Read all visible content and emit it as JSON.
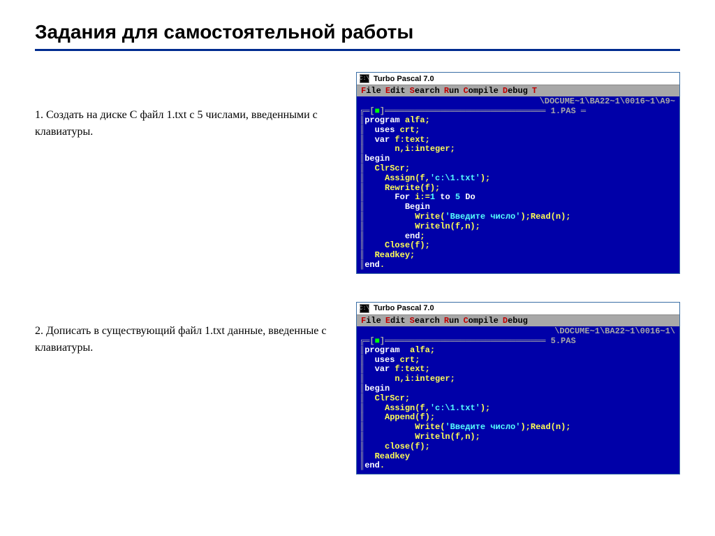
{
  "slide": {
    "title": "Задания для самостоятельной работы"
  },
  "task1": {
    "text": "1. Создать на  диске  C  файл  1.txt  с  5 числами,  введенными с клавиатуры."
  },
  "task2": {
    "text": "2. Дописать  в  существующий  файл  1.txt данные,  введенные с клавиатуры."
  },
  "tp": {
    "app_title": "Turbo Pascal 7.0",
    "cmd_glyph": "C:\\",
    "menu": {
      "file": "File",
      "edit": "Edit",
      "search": "Search",
      "run": "Run",
      "compile": "Compile",
      "debug": "Debug",
      "tools": "Tools"
    }
  },
  "win1": {
    "path": "\\DOCUME~1\\BA22~1\\0016~1\\A9~",
    "filename": "1.PAS",
    "code": [
      {
        "i": 0,
        "seg": [
          {
            "c": "kw",
            "t": "program"
          },
          {
            "c": "id",
            "t": " alfa;"
          }
        ]
      },
      {
        "i": 1,
        "seg": [
          {
            "c": "kw",
            "t": "uses "
          },
          {
            "c": "id",
            "t": "crt;"
          }
        ]
      },
      {
        "i": 1,
        "seg": [
          {
            "c": "kw",
            "t": "var "
          },
          {
            "c": "id",
            "t": "f:text;"
          }
        ]
      },
      {
        "i": 3,
        "seg": [
          {
            "c": "id",
            "t": "n,i:integer;"
          }
        ]
      },
      {
        "i": 0,
        "seg": [
          {
            "c": "kw",
            "t": "begin"
          }
        ]
      },
      {
        "i": 1,
        "seg": [
          {
            "c": "id",
            "t": "ClrScr;"
          }
        ]
      },
      {
        "i": 2,
        "seg": [
          {
            "c": "id",
            "t": "Assign(f,"
          },
          {
            "c": "str",
            "t": "'c:\\1.txt'"
          },
          {
            "c": "id",
            "t": ");"
          }
        ]
      },
      {
        "i": 2,
        "seg": [
          {
            "c": "id",
            "t": "Rewrite(f);"
          }
        ]
      },
      {
        "i": 3,
        "seg": [
          {
            "c": "kw",
            "t": "For "
          },
          {
            "c": "id",
            "t": "i:="
          },
          {
            "c": "num-lit",
            "t": "1"
          },
          {
            "c": "kw",
            "t": " to "
          },
          {
            "c": "num-lit",
            "t": "5"
          },
          {
            "c": "kw",
            "t": " Do"
          }
        ]
      },
      {
        "i": 4,
        "seg": [
          {
            "c": "kw",
            "t": "Begin"
          }
        ]
      },
      {
        "i": 5,
        "seg": [
          {
            "c": "id",
            "t": "Write("
          },
          {
            "c": "str",
            "t": "'Введите число'"
          },
          {
            "c": "id",
            "t": ");Read(n);"
          }
        ]
      },
      {
        "i": 5,
        "seg": [
          {
            "c": "id",
            "t": "Writeln(f,n);"
          }
        ]
      },
      {
        "i": 4,
        "seg": [
          {
            "c": "kw",
            "t": "end"
          },
          {
            "c": "id",
            "t": ";"
          }
        ]
      },
      {
        "i": 2,
        "seg": [
          {
            "c": "id",
            "t": "Close(f);"
          }
        ]
      },
      {
        "i": 1,
        "seg": [
          {
            "c": "id",
            "t": "Readkey;"
          }
        ]
      },
      {
        "i": 0,
        "seg": [
          {
            "c": "kw",
            "t": "end"
          },
          {
            "c": "id",
            "t": "."
          }
        ]
      }
    ]
  },
  "win2": {
    "path": "\\DOCUME~1\\BA22~1\\0016~1\\",
    "filename": "5.PAS",
    "code": [
      {
        "i": 0,
        "seg": [
          {
            "c": "kw",
            "t": "program"
          },
          {
            "c": "id",
            "t": "  alfa;"
          }
        ]
      },
      {
        "i": 1,
        "seg": [
          {
            "c": "kw",
            "t": "uses "
          },
          {
            "c": "id",
            "t": "crt;"
          }
        ]
      },
      {
        "i": 1,
        "seg": [
          {
            "c": "kw",
            "t": "var "
          },
          {
            "c": "id",
            "t": "f:text;"
          }
        ]
      },
      {
        "i": 3,
        "seg": [
          {
            "c": "id",
            "t": "n,i:integer;"
          }
        ]
      },
      {
        "i": 0,
        "seg": [
          {
            "c": "kw",
            "t": "begin"
          }
        ]
      },
      {
        "i": 1,
        "seg": [
          {
            "c": "id",
            "t": "ClrScr;"
          }
        ]
      },
      {
        "i": 2,
        "seg": [
          {
            "c": "id",
            "t": "Assign(f,"
          },
          {
            "c": "str",
            "t": "'c:\\1.txt'"
          },
          {
            "c": "id",
            "t": ");"
          }
        ]
      },
      {
        "i": 2,
        "seg": [
          {
            "c": "id",
            "t": "Append(f);"
          }
        ]
      },
      {
        "i": 5,
        "seg": [
          {
            "c": "id",
            "t": "Write("
          },
          {
            "c": "str",
            "t": "'Введите число'"
          },
          {
            "c": "id",
            "t": ");Read(n);"
          }
        ]
      },
      {
        "i": 5,
        "seg": [
          {
            "c": "id",
            "t": "Writeln(f,n);"
          }
        ]
      },
      {
        "i": 2,
        "seg": [
          {
            "c": "id",
            "t": "close(f);"
          }
        ]
      },
      {
        "i": 1,
        "seg": [
          {
            "c": "id",
            "t": "Readkey"
          }
        ]
      },
      {
        "i": 0,
        "seg": [
          {
            "c": "kw",
            "t": "end"
          },
          {
            "c": "id",
            "t": "."
          }
        ]
      }
    ]
  }
}
